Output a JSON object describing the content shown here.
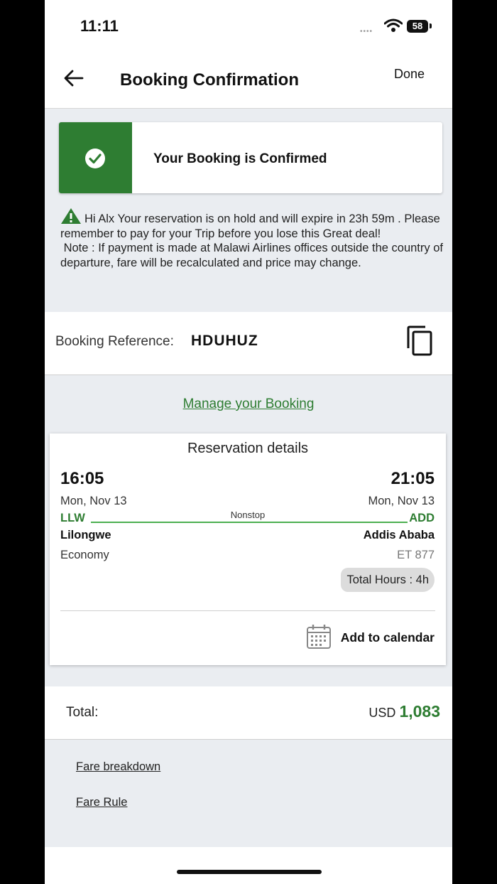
{
  "status": {
    "time": "11:11",
    "battery": "58"
  },
  "header": {
    "title": "Booking Confirmation",
    "done_label": "Done"
  },
  "confirmation": {
    "text": "Your Booking is Confirmed"
  },
  "notice": {
    "line1": "Hi Alx Your reservation is on hold and will expire in 23h 59m . Please remember to pay for your Trip before you lose this Great deal!",
    "line2": "Note : If payment is made at Malawi Airlines offices outside the country of departure, fare will be recalculated and price may change."
  },
  "reference": {
    "label": "Booking Reference:",
    "code": "HDUHUZ"
  },
  "manage_link": "Manage your Booking",
  "reservation": {
    "title": "Reservation details",
    "departure": {
      "time": "16:05",
      "date": "Mon, Nov 13",
      "code": "LLW",
      "city": "Lilongwe"
    },
    "arrival": {
      "time": "21:05",
      "date": "Mon, Nov 13",
      "code": "ADD",
      "city": "Addis Ababa"
    },
    "stops": "Nonstop",
    "cabin": "Economy",
    "flight_number": "ET 877",
    "total_hours": "Total Hours : 4h",
    "add_calendar": "Add to calendar"
  },
  "total": {
    "label": "Total:",
    "currency": "USD",
    "amount": "1,083"
  },
  "links": {
    "fare_breakdown": "Fare breakdown",
    "fare_rule": "Fare Rule"
  },
  "colors": {
    "accent_green": "#2e7d32",
    "route_line": "#4caf50"
  }
}
